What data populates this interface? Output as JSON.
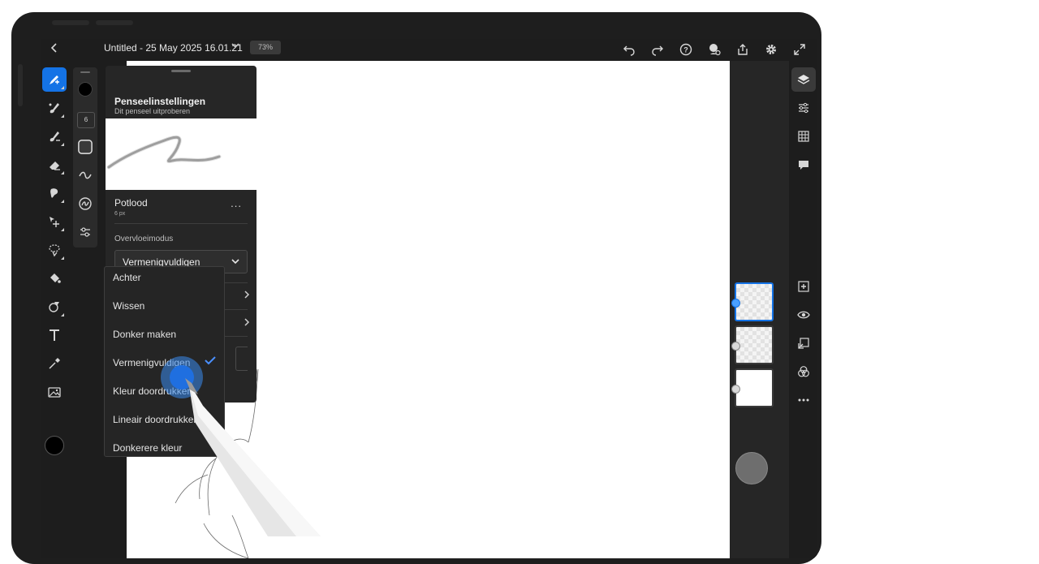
{
  "document": {
    "title": "Untitled - 25 May 2025 16.01.21",
    "zoom": "73%"
  },
  "topbar": {
    "icons": [
      "back-icon",
      "chevron-down-icon",
      "undo-icon",
      "redo-icon",
      "help-icon",
      "share-user-icon",
      "upload-icon",
      "settings-icon",
      "fullscreen-icon"
    ]
  },
  "left_tools": [
    "pixel-brush-icon",
    "live-brush-icon",
    "paint-brush-icon",
    "eraser-icon",
    "smudge-icon",
    "move-icon",
    "lasso-icon",
    "fill-icon",
    "shape-icon",
    "text-icon",
    "eyedropper-icon",
    "image-icon"
  ],
  "brush_rail": {
    "size_value": "6"
  },
  "brush_panel": {
    "title": "Penseelinstellingen",
    "subtitle": "Dit penseel uitproberen",
    "brush_name": "Potlood",
    "brush_size": "6 px",
    "more": "...",
    "blend_label": "Overvloeimodus",
    "blend_value": "Vermenigvuldigen"
  },
  "blend_menu": {
    "items": [
      "Achter",
      "Wissen",
      "Donker maken",
      "Vermenigvuldigen",
      "Kleur doordrukken",
      "Lineair doordrukken",
      "Donkerere kleur"
    ],
    "selected": "Vermenigvuldigen"
  },
  "right_rail": {
    "icons": [
      "layers-icon",
      "adjustments-icon",
      "grid-icon",
      "comment-icon",
      "add-layer-icon",
      "visibility-icon",
      "import-icon",
      "blend-icon",
      "more-icon"
    ]
  },
  "colors": {
    "accent": "#1473e6",
    "app_bg": "#1d1d1d",
    "panel_bg": "#262626",
    "current_color": "#000000"
  }
}
